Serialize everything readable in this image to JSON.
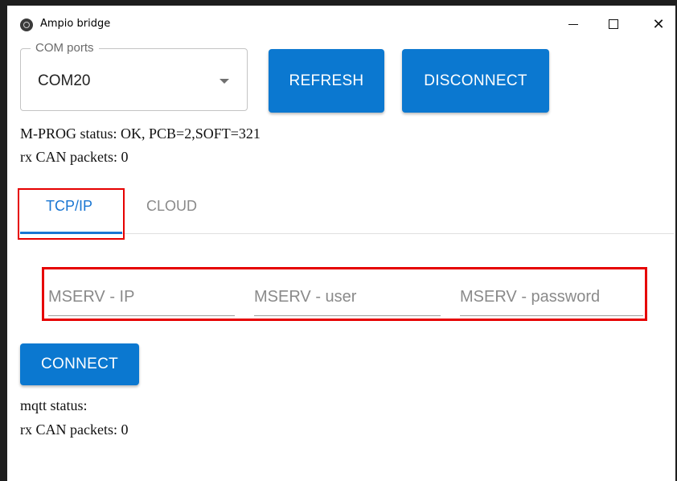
{
  "window": {
    "title": "Ampio bridge"
  },
  "com": {
    "legend": "COM ports",
    "selected": "COM20"
  },
  "buttons": {
    "refresh": "REFRESH",
    "disconnect": "DISCONNECT",
    "connect": "CONNECT"
  },
  "status": {
    "mprog": "M-PROG status: OK, PCB=2,SOFT=321",
    "rx_top": "rx CAN packets: 0",
    "mqtt": "mqtt status:",
    "rx_bottom": "rx CAN packets: 0"
  },
  "tabs": [
    {
      "label": "TCP/IP",
      "active": true
    },
    {
      "label": "CLOUD",
      "active": false
    }
  ],
  "fields": {
    "ip_placeholder": "MSERV - IP",
    "user_placeholder": "MSERV - user",
    "password_placeholder": "MSERV - password"
  },
  "colors": {
    "primary": "#0b78d0",
    "tab_active": "#1976d2",
    "highlight": "#e60000"
  }
}
